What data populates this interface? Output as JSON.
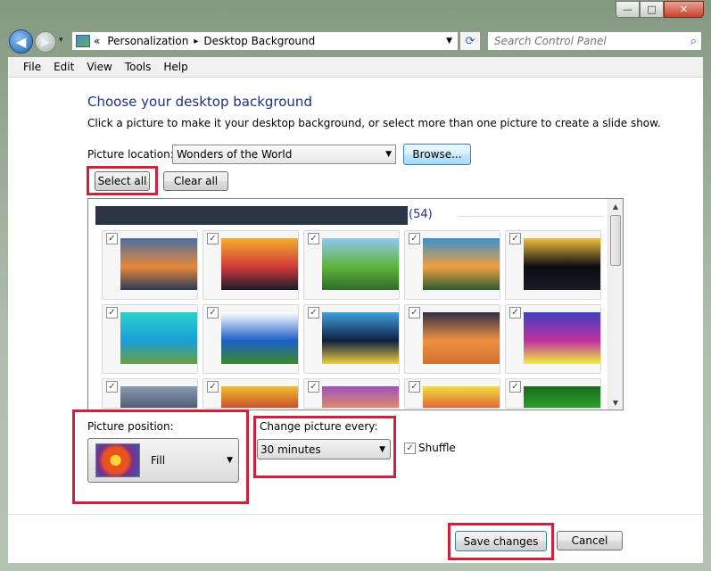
{
  "window": {
    "min_glyph": "—",
    "max_glyph": "□",
    "close_glyph": "✕"
  },
  "nav": {
    "back_glyph": "◀",
    "forward_glyph": "▶",
    "breadcrumb_prefix": "«",
    "breadcrumb": [
      "Personalization",
      "Desktop Background"
    ],
    "separator": "▸",
    "search_placeholder": "Search Control Panel"
  },
  "menu": [
    "File",
    "Edit",
    "View",
    "Tools",
    "Help"
  ],
  "page": {
    "title": "Choose your desktop background",
    "subtitle": "Click a picture to make it your desktop background, or select more than one picture to create a slide show.",
    "picture_location_label": "Picture location:",
    "picture_location_value": "Wonders of the World",
    "browse_label": "Browse...",
    "select_all_label": "Select all",
    "clear_all_label": "Clear all"
  },
  "gallery": {
    "group_count": "(54)",
    "check_glyph": "✓",
    "thumbnails": [
      {
        "subject": "sunset-beach",
        "colors": [
          "#e8883a",
          "#4a6ea0",
          "#2a3a55"
        ]
      },
      {
        "subject": "times-square",
        "colors": [
          "#d23a3a",
          "#f0b02a",
          "#1b1b2b"
        ]
      },
      {
        "subject": "green-hills-planet",
        "colors": [
          "#5fb43a",
          "#8fc8f0",
          "#2f6b2a"
        ]
      },
      {
        "subject": "tropical-sunset",
        "colors": [
          "#f2a040",
          "#3a8fd0",
          "#2a5a30"
        ]
      },
      {
        "subject": "eiffel-tower-night",
        "colors": [
          "#0b0b12",
          "#f0c040",
          "#1a1a28"
        ]
      },
      {
        "subject": "lagoon-bay",
        "colors": [
          "#1a9fd8",
          "#2ad0c8",
          "#6aa040"
        ]
      },
      {
        "subject": "fisheye-meadow",
        "colors": [
          "#1a5fc8",
          "#ffffff",
          "#3a8a2a"
        ]
      },
      {
        "subject": "city-skyline-night",
        "colors": [
          "#0f2040",
          "#40a0e0",
          "#f0d040"
        ]
      },
      {
        "subject": "city-dusk",
        "colors": [
          "#f09040",
          "#30304a",
          "#d07030"
        ]
      },
      {
        "subject": "city-purple-lights",
        "colors": [
          "#c030a0",
          "#4040c0",
          "#f0f040"
        ]
      },
      {
        "subject": "skyline-grey",
        "colors": [
          "#3a4a60",
          "#8a9ab0",
          "#20283a"
        ]
      },
      {
        "subject": "times-square-2",
        "colors": [
          "#c02a2a",
          "#f0c030",
          "#202040"
        ]
      },
      {
        "subject": "city-sunset",
        "colors": [
          "#f0a050",
          "#a050c0",
          "#304070"
        ]
      },
      {
        "subject": "signs-street",
        "colors": [
          "#e04030",
          "#f0e040",
          "#304060"
        ]
      },
      {
        "subject": "green-rose",
        "colors": [
          "#30b030",
          "#1a6a1a",
          "#0a2a0a"
        ]
      }
    ]
  },
  "position": {
    "label": "Picture position:",
    "value": "Fill"
  },
  "interval": {
    "label": "Change picture every:",
    "value": "30 minutes",
    "shuffle_label": "Shuffle"
  },
  "footer": {
    "save_label": "Save changes",
    "cancel_label": "Cancel"
  },
  "colors": {
    "highlight": "#d0213a",
    "title_blue": "#1e3287",
    "group_header": "#2b3444"
  }
}
